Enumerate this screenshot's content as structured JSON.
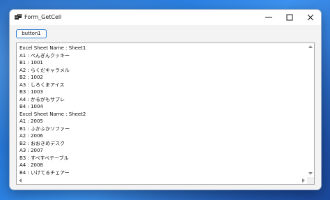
{
  "window": {
    "title": "Form_GetCell",
    "icon": "form-app-icon",
    "controls": {
      "minimize": "minimize-icon",
      "maximize": "maximize-icon",
      "close": "close-icon"
    }
  },
  "button1": {
    "label": "button1"
  },
  "textbox": {
    "lines": [
      "Excel Sheet Name : Sheet1",
      "A1 : ぺんぎんクッキー",
      "B1 : 1001",
      "A2 : らくだキャラメル",
      "B2 : 1002",
      "A3 : しろくまアイス",
      "B3 : 1003",
      "A4 : かるがもサブレ",
      "B4 : 1004",
      "Excel Sheet Name : Sheet2",
      "A1 : 2005",
      "B1 : ふかふかソファー",
      "A2 : 2006",
      "B2 : おおきめデスク",
      "A3 : 2007",
      "B3 : すべすべテーブル",
      "A4 : 2008",
      "B4 : いけてるチェアー"
    ]
  }
}
